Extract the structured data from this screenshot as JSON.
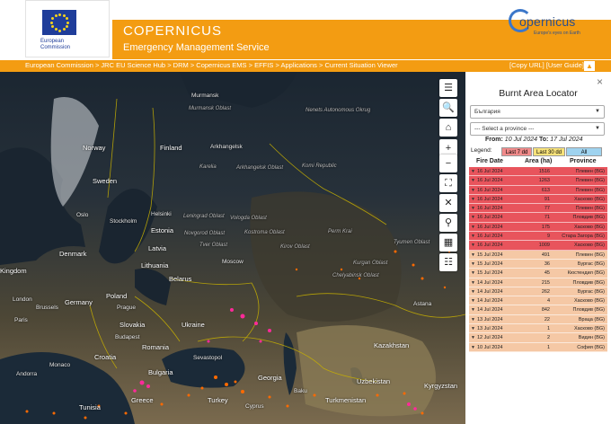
{
  "header": {
    "ec_label": "European Commission",
    "title": "COPERNICUS",
    "subtitle": "Emergency Management Service",
    "logo_word": "opernicus",
    "logo_tag": "Europe's eyes on Earth"
  },
  "breadcrumb": {
    "text": "European Commission > JRC EU Science Hub > DRM > Copernicus EMS > EFFIS > Applications > Current Situation Viewer",
    "right": "[Copy URL] [User Guide]",
    "up": "▲"
  },
  "map": {
    "labels": [
      {
        "t": "Murmansk",
        "cls": ""
      },
      {
        "t": "Murmansk Oblast",
        "cls": "region"
      },
      {
        "t": "Norway",
        "cls": "big"
      },
      {
        "t": "Finland",
        "cls": "big"
      },
      {
        "t": "Sweden",
        "cls": "big"
      },
      {
        "t": "Karelia",
        "cls": "region"
      },
      {
        "t": "Arkhangelsk",
        "cls": ""
      },
      {
        "t": "Arkhangelsk Oblast",
        "cls": "region"
      },
      {
        "t": "Nenets Autonomous Okrug",
        "cls": "region"
      },
      {
        "t": "Komi Republic",
        "cls": "region"
      },
      {
        "t": "Oslo",
        "cls": ""
      },
      {
        "t": "Stockholm",
        "cls": ""
      },
      {
        "t": "Helsinki",
        "cls": ""
      },
      {
        "t": "Leningrad Oblast",
        "cls": "region"
      },
      {
        "t": "Vologda Oblast",
        "cls": "region"
      },
      {
        "t": "Estonia",
        "cls": "big"
      },
      {
        "t": "Novgorod Oblast",
        "cls": "region"
      },
      {
        "t": "Kostroma Oblast",
        "cls": "region"
      },
      {
        "t": "Perm Krai",
        "cls": "region"
      },
      {
        "t": "Latvia",
        "cls": "big"
      },
      {
        "t": "Tver Oblast",
        "cls": "region"
      },
      {
        "t": "Kirov Oblast",
        "cls": "region"
      },
      {
        "t": "Denmark",
        "cls": "big"
      },
      {
        "t": "Moscow",
        "cls": ""
      },
      {
        "t": "Kingdom",
        "cls": "big"
      },
      {
        "t": "Lithuania",
        "cls": "big"
      },
      {
        "t": "Belarus",
        "cls": "big"
      },
      {
        "t": "London",
        "cls": ""
      },
      {
        "t": "Germany",
        "cls": "big"
      },
      {
        "t": "Poland",
        "cls": "big"
      },
      {
        "t": "Slovakia",
        "cls": "big"
      },
      {
        "t": "Ukraine",
        "cls": "big"
      },
      {
        "t": "Budapest",
        "cls": ""
      },
      {
        "t": "Romania",
        "cls": "big"
      },
      {
        "t": "Monaco",
        "cls": ""
      },
      {
        "t": "Croatia",
        "cls": "big"
      },
      {
        "t": "Bulgaria",
        "cls": "big"
      },
      {
        "t": "Andorra",
        "cls": ""
      },
      {
        "t": "Greece",
        "cls": "big"
      },
      {
        "t": "Turkey",
        "cls": "big"
      },
      {
        "t": "Georgia",
        "cls": "big"
      },
      {
        "t": "Baku",
        "cls": ""
      },
      {
        "t": "Kazakhstan",
        "cls": "big"
      },
      {
        "t": "Astana",
        "cls": ""
      },
      {
        "t": "Uzbekistan",
        "cls": "big"
      },
      {
        "t": "Turkmenistan",
        "cls": "big"
      },
      {
        "t": "Kyrgyzstan",
        "cls": "big"
      },
      {
        "t": "Sevastopol",
        "cls": ""
      },
      {
        "t": "Tyumen Oblast",
        "cls": "region"
      },
      {
        "t": "Chelyabinsk Oblast",
        "cls": "region"
      },
      {
        "t": "Kurgan Oblast",
        "cls": "region"
      },
      {
        "t": "Brussels",
        "cls": ""
      },
      {
        "t": "Paris",
        "cls": ""
      },
      {
        "t": "Prague",
        "cls": ""
      },
      {
        "t": "Tunisia",
        "cls": "big"
      },
      {
        "t": "Cyprus",
        "cls": ""
      }
    ]
  },
  "toolbar": [
    "☰",
    "🔍",
    "⌂",
    "+",
    "−",
    "⛶",
    "✕",
    "⚲",
    "▦",
    "☷"
  ],
  "panel": {
    "close": "×",
    "title": "Burnt Area Locator",
    "country": "България",
    "province_placeholder": "--- Select a province ---",
    "from_label": "From:",
    "from_date": "10 Jul 2024",
    "to_label": "To:",
    "to_date": "17 Jul 2024",
    "legend_label": "Legend:",
    "legend_items": [
      "Last 7 dd",
      "Last 30 dd",
      "All"
    ],
    "columns": [
      "Fire Date",
      "Area (ha)",
      "Province"
    ],
    "rows": [
      {
        "date": "16 Jul 2024",
        "area": "1516",
        "prov": "Плевен (BG)",
        "red": true
      },
      {
        "date": "16 Jul 2024",
        "area": "1263",
        "prov": "Плевен (BG)",
        "red": true
      },
      {
        "date": "16 Jul 2024",
        "area": "613",
        "prov": "Плевен (BG)",
        "red": true
      },
      {
        "date": "16 Jul 2024",
        "area": "91",
        "prov": "Хасково (BG)",
        "red": true
      },
      {
        "date": "16 Jul 2024",
        "area": "77",
        "prov": "Плевен (BG)",
        "red": true
      },
      {
        "date": "16 Jul 2024",
        "area": "71",
        "prov": "Пловдив (BG)",
        "red": true
      },
      {
        "date": "16 Jul 2024",
        "area": "175",
        "prov": "Хасково (BG)",
        "red": true
      },
      {
        "date": "16 Jul 2024",
        "area": "9",
        "prov": "Стара Загора (BG)",
        "red": true
      },
      {
        "date": "16 Jul 2024",
        "area": "1009",
        "prov": "Хасково (BG)",
        "red": true
      },
      {
        "date": "15 Jul 2024",
        "area": "491",
        "prov": "Плевен (BG)",
        "red": false
      },
      {
        "date": "15 Jul 2024",
        "area": "36",
        "prov": "Бургас (BG)",
        "red": false
      },
      {
        "date": "15 Jul 2024",
        "area": "45",
        "prov": "Кюстендил (BG)",
        "red": false
      },
      {
        "date": "14 Jul 2024",
        "area": "215",
        "prov": "Пловдив (BG)",
        "red": false
      },
      {
        "date": "14 Jul 2024",
        "area": "262",
        "prov": "Бургас (BG)",
        "red": false
      },
      {
        "date": "14 Jul 2024",
        "area": "4",
        "prov": "Хасково (BG)",
        "red": false
      },
      {
        "date": "14 Jul 2024",
        "area": "842",
        "prov": "Пловдив (BG)",
        "red": false
      },
      {
        "date": "13 Jul 2024",
        "area": "22",
        "prov": "Враца (BG)",
        "red": false
      },
      {
        "date": "13 Jul 2024",
        "area": "1",
        "prov": "Хасково (BG)",
        "red": false
      },
      {
        "date": "12 Jul 2024",
        "area": "2",
        "prov": "Видин (BG)",
        "red": false
      },
      {
        "date": "10 Jul 2024",
        "area": "1",
        "prov": "София (BG)",
        "red": false
      }
    ]
  },
  "colors": {
    "orange": "#f39c12",
    "row_recent": "#e8545c",
    "row_older": "#f5c8a5",
    "legend_7": "#f08a8a",
    "legend_30": "#f7e27a",
    "legend_all": "#9fd3ef"
  }
}
